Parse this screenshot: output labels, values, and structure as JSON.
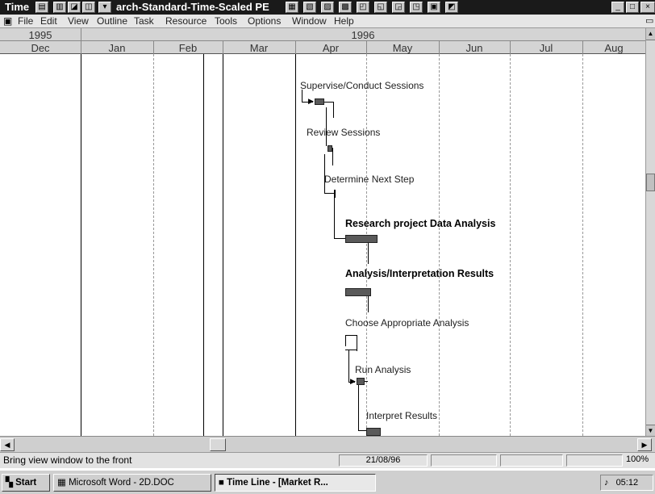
{
  "window": {
    "app_short": "Time",
    "title": "arch-Standard-Time-Scaled PE",
    "min": "_",
    "max": "□",
    "close": "×"
  },
  "menu": [
    "File",
    "Edit",
    "View",
    "Outline",
    "Task",
    "Resource",
    "Tools",
    "Options",
    "Window",
    "Help"
  ],
  "timescale": {
    "years": [
      "1995",
      "1996"
    ],
    "months": [
      "Dec",
      "Jan",
      "Feb",
      "Mar",
      "Apr",
      "May",
      "Jun",
      "Jul",
      "Aug"
    ]
  },
  "tasks": [
    {
      "name": "Supervise/Conduct Sessions",
      "bold": false
    },
    {
      "name": "Review Sessions",
      "bold": false
    },
    {
      "name": "Determine Next Step",
      "bold": false
    },
    {
      "name": "Research project Data Analysis",
      "bold": true
    },
    {
      "name": "Analysis/Interpretation Results",
      "bold": true
    },
    {
      "name": "Choose Appropriate Analysis",
      "bold": false
    },
    {
      "name": "Run Analysis",
      "bold": false
    },
    {
      "name": "Interpret Results",
      "bold": false
    }
  ],
  "status": {
    "message": "Bring view window to the front",
    "date": "21/08/96",
    "zoom": "100%"
  },
  "taskbar": {
    "start": "Start",
    "word": "Microsoft Word - 2D.DOC",
    "timeline": "Time Line - [Market R...",
    "clock": "05:12"
  }
}
